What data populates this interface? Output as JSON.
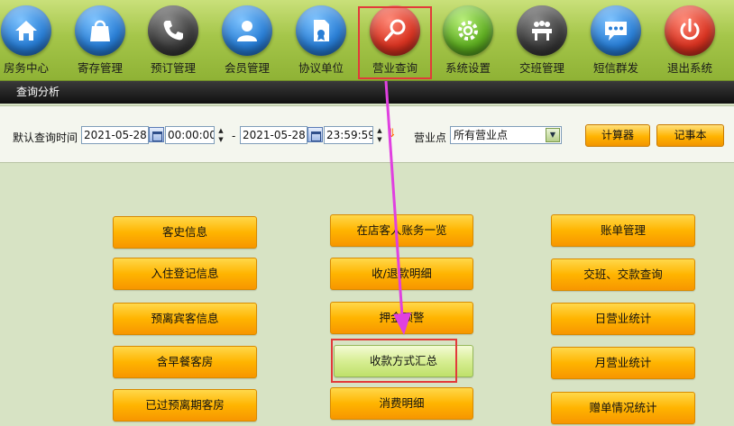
{
  "toolbar": {
    "items": [
      {
        "label": "房务中心",
        "icon": "house-icon"
      },
      {
        "label": "寄存管理",
        "icon": "shopping-bag-icon"
      },
      {
        "label": "预订管理",
        "icon": "phone-icon"
      },
      {
        "label": "会员管理",
        "icon": "user-icon"
      },
      {
        "label": "协议单位",
        "icon": "document-icon"
      },
      {
        "label": "营业查询",
        "icon": "search-icon"
      },
      {
        "label": "系统设置",
        "icon": "gear-icon"
      },
      {
        "label": "交班管理",
        "icon": "meeting-icon"
      },
      {
        "label": "短信群发",
        "icon": "chat-icon"
      },
      {
        "label": "退出系统",
        "icon": "power-icon"
      }
    ],
    "active": "营业查询"
  },
  "title": "查询分析",
  "filter": {
    "date_label": "默认查询时间",
    "start_date": "2021-05-28",
    "start_time": "00:00:00",
    "dash": "-",
    "end_date": "2021-05-28",
    "end_time": "23:59:59",
    "outlet_label": "营业点",
    "outlet_value": "所有营业点",
    "calculator_button": "计算器",
    "notepad_button": "记事本"
  },
  "buttons": {
    "col1": [
      "客史信息",
      "入住登记信息",
      "预离宾客信息",
      "含早餐客房",
      "已过预离期客房"
    ],
    "col2": [
      "在店客人账务一览",
      "收/退款明细",
      "押金预警",
      "收款方式汇总",
      "消费明细"
    ],
    "col3": [
      "账单管理",
      "交班、交款查询",
      "日营业统计",
      "月营业统计",
      "赠单情况统计"
    ],
    "highlighted": "收款方式汇总"
  },
  "colors": {
    "highlight_box": "#e23a3a",
    "annotation_arrow": "#e040e0",
    "button_orange": "#ffb400"
  }
}
